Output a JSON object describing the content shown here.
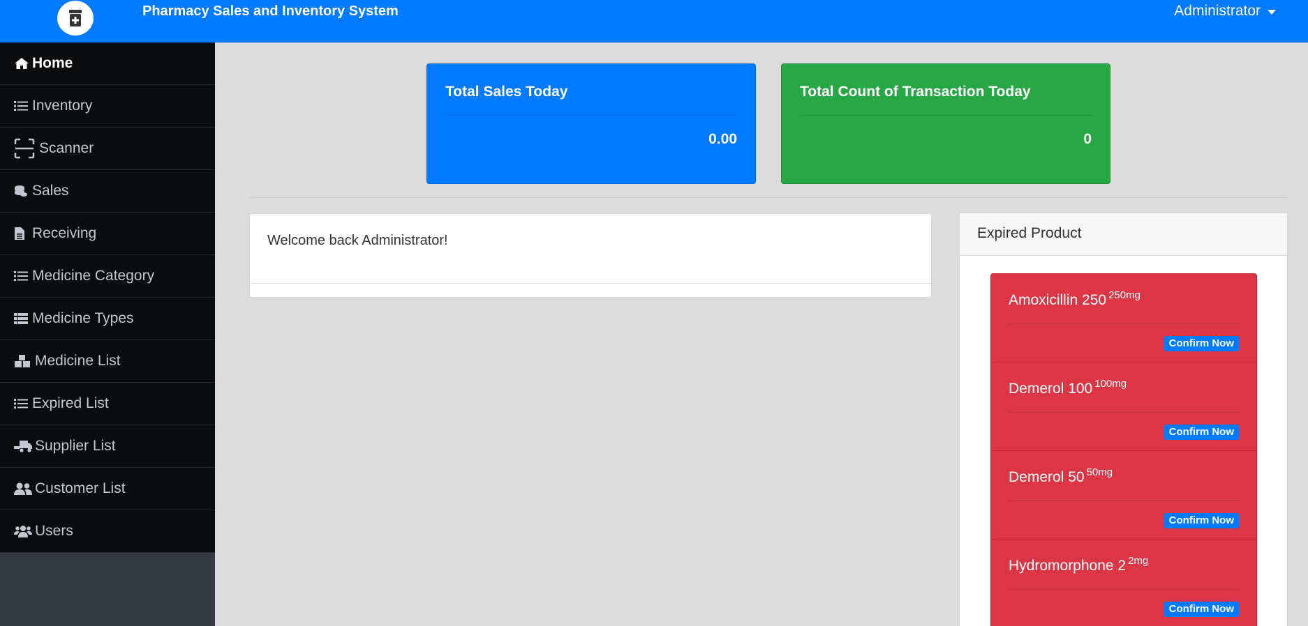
{
  "app": {
    "title": "Pharmacy Sales and Inventory System",
    "user": "Administrator"
  },
  "colors": {
    "primary": "#007bff",
    "success": "#28a745",
    "danger": "#dc3545",
    "sidebar": "#0b0c0e"
  },
  "sidebar": {
    "items": [
      {
        "label": "Home",
        "icon": "home-icon",
        "active": true
      },
      {
        "label": "Inventory",
        "icon": "list-icon"
      },
      {
        "label": "Scanner",
        "icon": "scan-icon"
      },
      {
        "label": "Sales",
        "icon": "coins-icon"
      },
      {
        "label": "Receiving",
        "icon": "file-icon"
      },
      {
        "label": "Medicine Category",
        "icon": "list-icon"
      },
      {
        "label": "Medicine Types",
        "icon": "table-icon"
      },
      {
        "label": "Medicine List",
        "icon": "boxes-icon"
      },
      {
        "label": "Expired List",
        "icon": "list-icon"
      },
      {
        "label": "Supplier List",
        "icon": "truck-icon"
      },
      {
        "label": "Customer List",
        "icon": "user-friends-icon"
      },
      {
        "label": "Users",
        "icon": "users-icon"
      }
    ]
  },
  "stats": {
    "sales_today": {
      "title": "Total Sales Today",
      "value": "0.00"
    },
    "transactions_today": {
      "title": "Total Count of Transaction Today",
      "value": "0"
    }
  },
  "welcome": {
    "message": "Welcome back Administrator!"
  },
  "expired": {
    "header": "Expired Product",
    "confirm_label": "Confirm Now",
    "items": [
      {
        "name": "Amoxicillin 250",
        "unit": "250mg"
      },
      {
        "name": "Demerol 100",
        "unit": "100mg"
      },
      {
        "name": "Demerol 50",
        "unit": "50mg"
      },
      {
        "name": "Hydromorphone 2",
        "unit": "2mg"
      }
    ]
  }
}
